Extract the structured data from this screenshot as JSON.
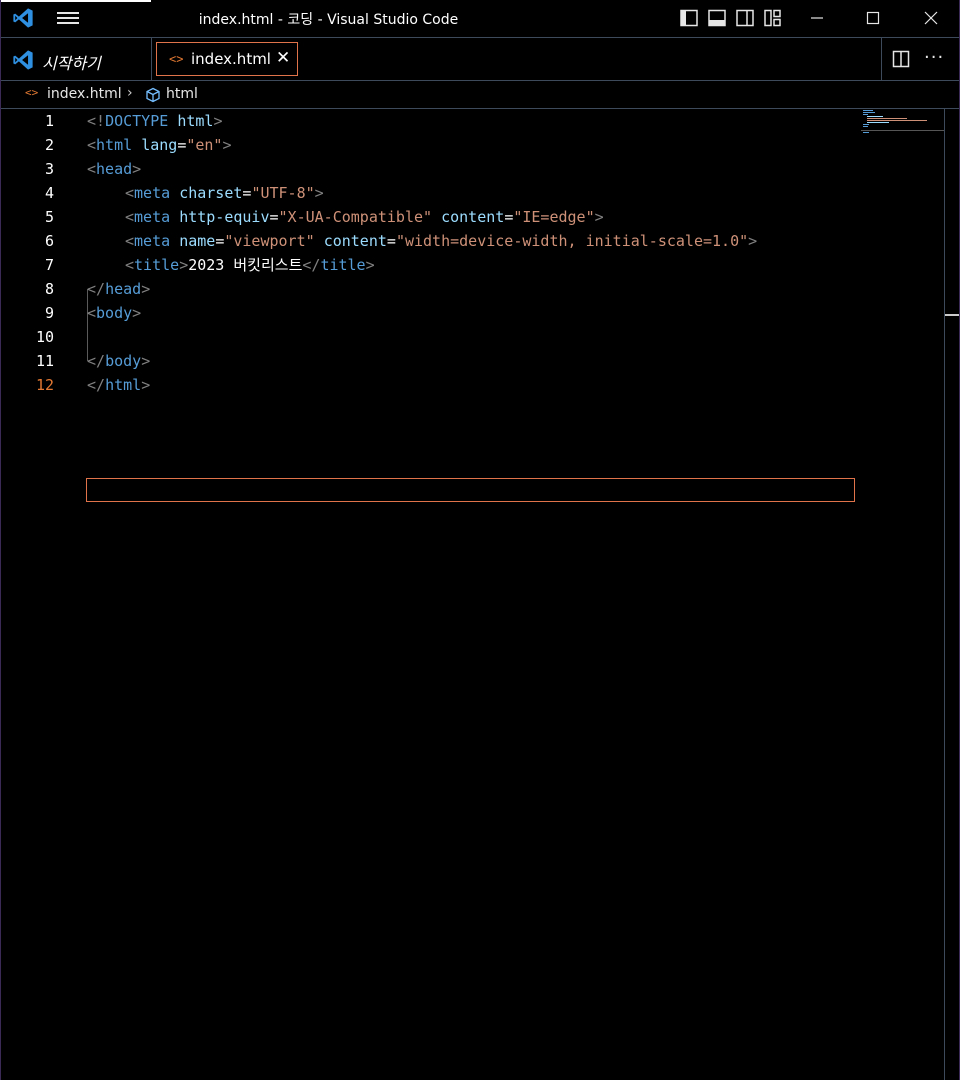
{
  "window": {
    "title": "index.html - 코딩 - Visual Studio Code"
  },
  "tabs": {
    "start_label": "시작하기",
    "active_label": "index.html",
    "close_glyph": "✕",
    "file_icon": "<>",
    "more_glyph": "···"
  },
  "breadcrumb": {
    "file": "index.html",
    "separator": "›",
    "symbol": "html"
  },
  "editor": {
    "current_line": 12,
    "line_numbers": [
      "1",
      "2",
      "3",
      "4",
      "5",
      "6",
      "7",
      "8",
      "9",
      "10",
      "11",
      "12"
    ],
    "lines": [
      "<!DOCTYPE html>",
      "<html lang=\"en\">",
      "<head>",
      "<meta charset=\"UTF-8\">",
      "<meta http-equiv=\"X-UA-Compatible\" content=\"IE=edge\">",
      "<meta name=\"viewport\" content=\"width=device-width, initial-scale=1.0\">",
      "<title>2023 버킷리스트</title>",
      "</head>",
      "<body>",
      "",
      "</body>",
      "</html>"
    ]
  },
  "colors": {
    "tag": "#569cd6",
    "attribute": "#9cdcfe",
    "string": "#ce9178",
    "punctuation": "#808080",
    "accent": "#e0734a",
    "vscode_blue": "#2f8fe0"
  },
  "icons": {
    "logo": "vscode-logo-icon",
    "menu": "hamburger-menu-icon",
    "layout": [
      "toggle-primary-sidebar-icon",
      "toggle-panel-icon",
      "toggle-secondary-sidebar-icon",
      "customize-layout-icon"
    ],
    "window": [
      "minimize-icon",
      "maximize-icon",
      "close-window-icon"
    ],
    "split": "split-editor-icon",
    "symbol": "symbol-cube-icon"
  }
}
